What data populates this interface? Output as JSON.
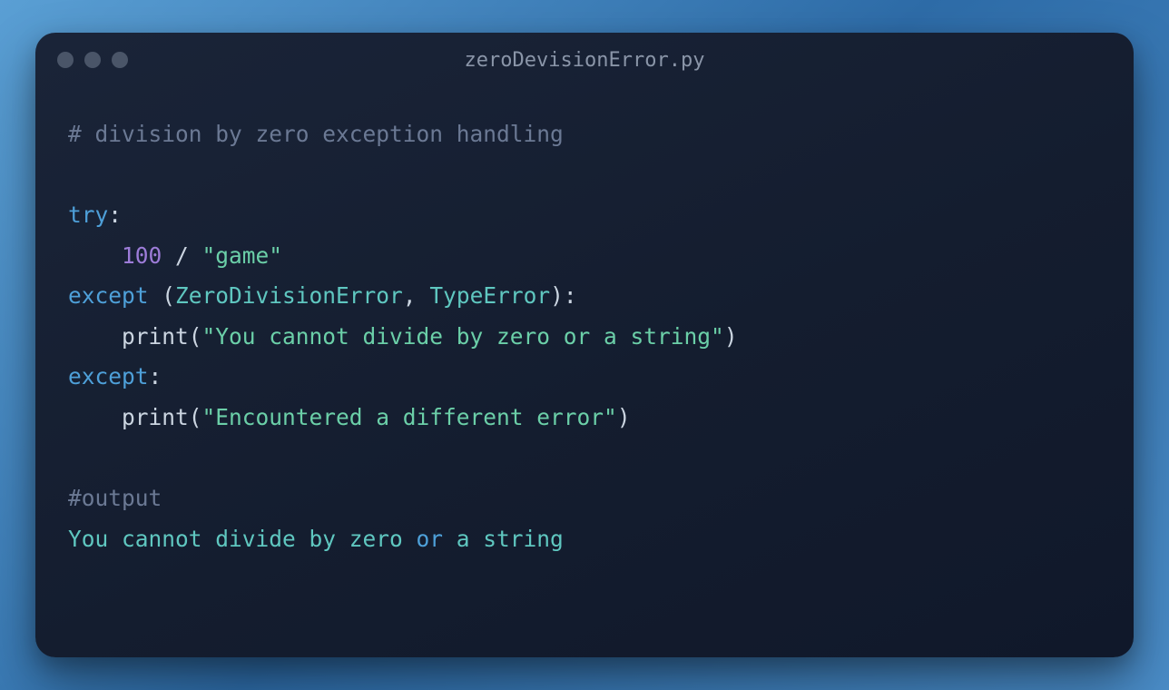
{
  "window": {
    "title": "zeroDevisionError.py"
  },
  "code": {
    "comment_header": "# division by zero exception handling",
    "kw_try": "try",
    "colon": ":",
    "indent": "    ",
    "num_100": "100",
    "op_div": " / ",
    "str_game": "\"game\"",
    "kw_except": "except",
    "paren_open": " (",
    "type_zde": "ZeroDivisionError",
    "comma_sp": ", ",
    "type_te": "TypeError",
    "paren_close": ")",
    "fn_print": "print",
    "call_open": "(",
    "call_close": ")",
    "str_msg1": "\"You cannot divide by zero or a string\"",
    "str_msg2": "\"Encountered a different error\"",
    "comment_output": "#output",
    "output_part1": "You cannot divide by zero ",
    "output_part2": "or",
    "output_part3": " a string"
  }
}
